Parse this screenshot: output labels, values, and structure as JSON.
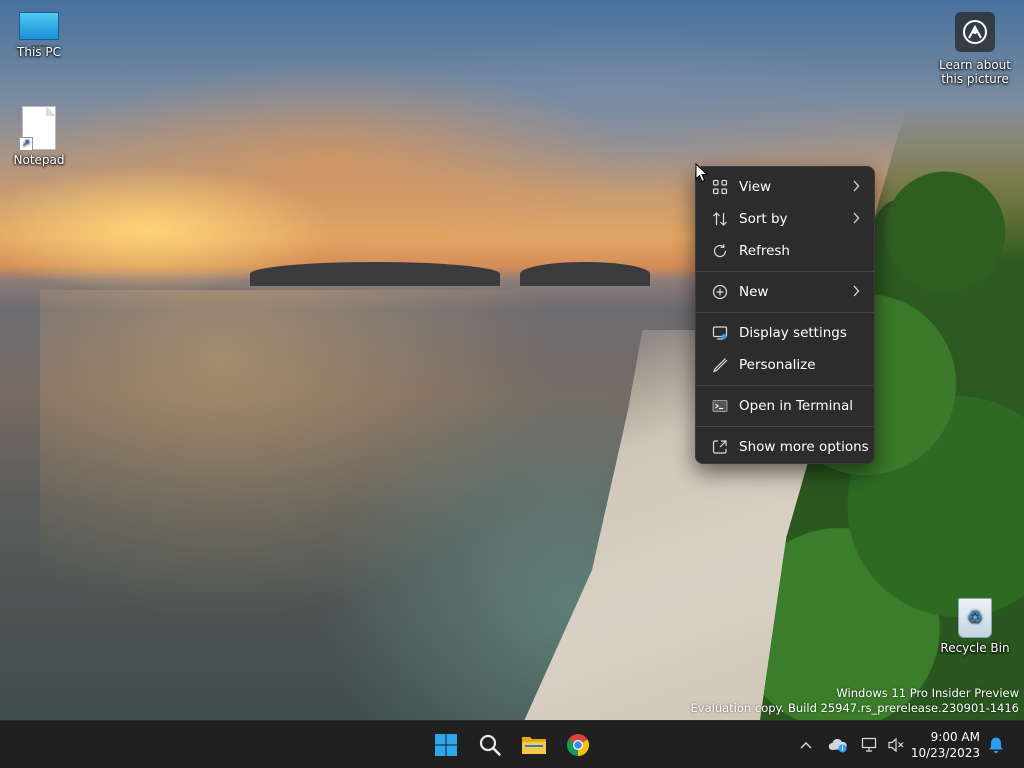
{
  "desktop": {
    "icons": [
      {
        "label": "This PC",
        "icon": "this-pc-icon"
      },
      {
        "label": "Notepad",
        "icon": "notepad-icon"
      },
      {
        "label": "Recycle Bin",
        "icon": "recycle-bin-icon"
      }
    ],
    "learn": {
      "line1": "Learn about",
      "line2": "this picture"
    }
  },
  "context_menu": {
    "items": [
      {
        "label": "View",
        "icon": "view-grid-icon",
        "submenu": true
      },
      {
        "label": "Sort by",
        "icon": "sort-arrows-icon",
        "submenu": true
      },
      {
        "label": "Refresh",
        "icon": "refresh-icon",
        "submenu": false
      },
      {
        "label": "New",
        "icon": "new-plus-icon",
        "submenu": true
      },
      {
        "label": "Display settings",
        "icon": "display-settings-icon",
        "submenu": false
      },
      {
        "label": "Personalize",
        "icon": "personalize-brush-icon",
        "submenu": false
      },
      {
        "label": "Open in Terminal",
        "icon": "terminal-icon",
        "submenu": false
      },
      {
        "label": "Show more options",
        "icon": "show-more-options-icon",
        "submenu": false
      }
    ]
  },
  "watermark": {
    "line1": "Windows 11 Pro Insider Preview",
    "line2": "Evaluation copy. Build 25947.rs_prerelease.230901-1416"
  },
  "taskbar": {
    "pinned": [
      "start-icon",
      "search-icon",
      "file-explorer-icon",
      "chrome-icon"
    ],
    "tray": [
      "chevron-up-icon",
      "onedrive-icon",
      "network-icon",
      "volume-muted-icon",
      "notification-bell-icon"
    ],
    "clock": {
      "time": "9:00 AM",
      "date": "10/23/2023"
    }
  },
  "colors": {
    "menu_bg": "#2c2c2c",
    "taskbar_bg": "#202020",
    "accent": "#2b9df0"
  }
}
